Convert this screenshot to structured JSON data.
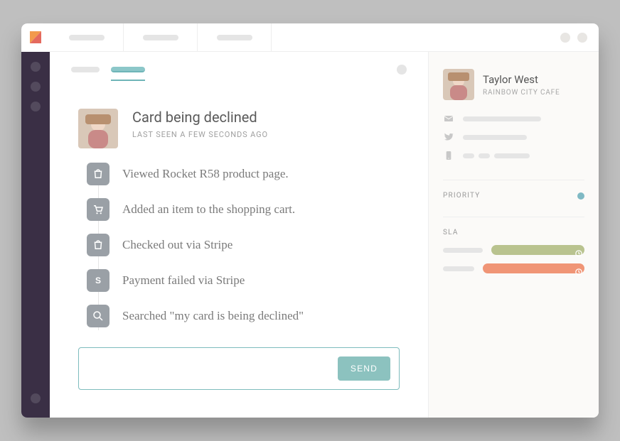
{
  "ticket": {
    "title": "Card being declined",
    "subtitle": "LAST SEEN A FEW SECONDS AGO"
  },
  "events": [
    {
      "icon": "bag-icon",
      "text": "Viewed Rocket R58 product page."
    },
    {
      "icon": "cart-icon",
      "text": "Added an item to the shopping cart."
    },
    {
      "icon": "bag-icon",
      "text": "Checked out via Stripe"
    },
    {
      "icon": "stripe-icon",
      "text": "Payment failed via Stripe"
    },
    {
      "icon": "search-icon",
      "text": "Searched \"my card is being declined\""
    }
  ],
  "reply": {
    "send_label": "SEND"
  },
  "customer": {
    "name": "Taylor West",
    "org": "RAINBOW CITY CAFE"
  },
  "sidebar_sections": {
    "priority_label": "PRIORITY",
    "sla_label": "SLA"
  }
}
